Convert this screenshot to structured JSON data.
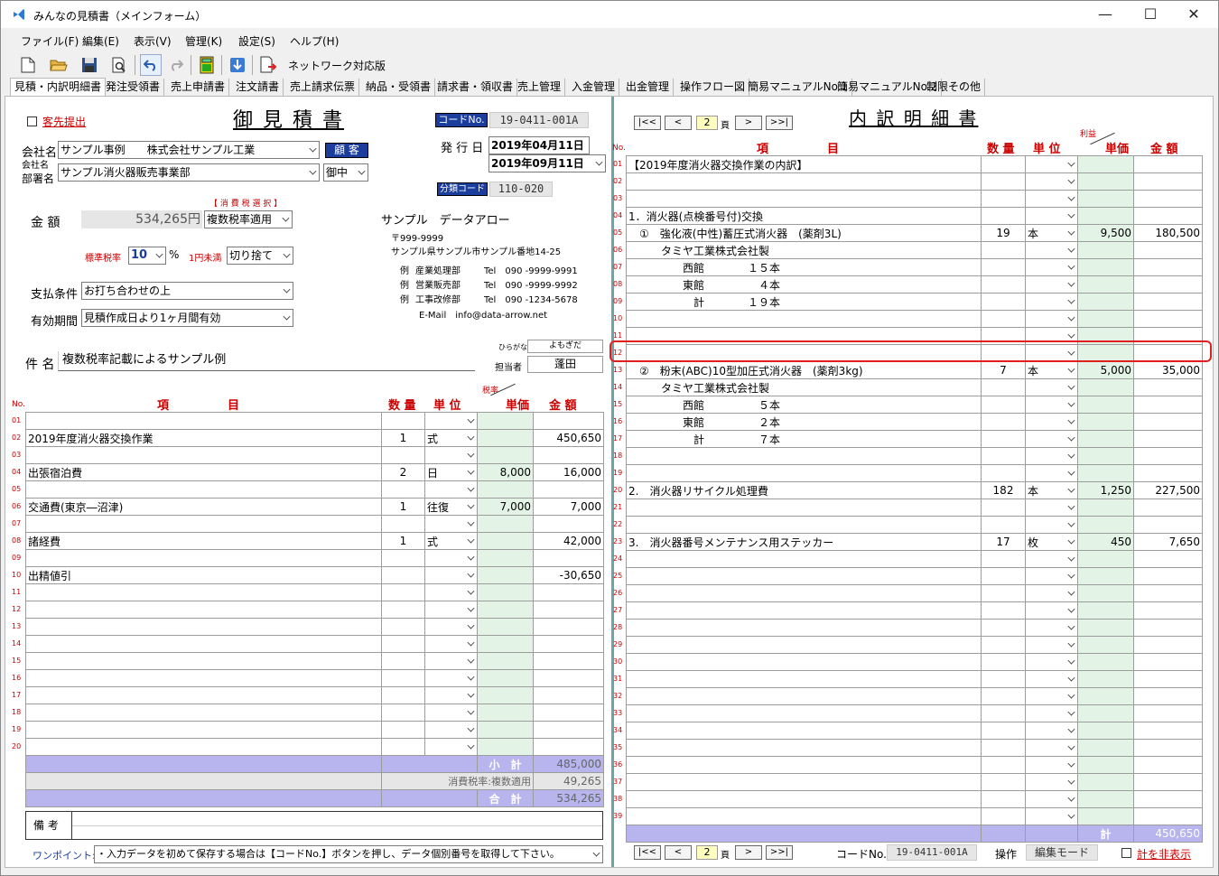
{
  "window": {
    "title": "みんなの見積書（メインフォーム）"
  },
  "menu": [
    "ファイル(F)",
    "編集(E)",
    "表示(V)",
    "管理(K)",
    "設定(S)",
    "ヘルプ(H)"
  ],
  "toolbar": {
    "network_label": "ネットワーク対応版"
  },
  "tabs": [
    "見積・内訳明細書",
    "発注受領書",
    "売上申請書",
    "注文請書",
    "売上請求伝票",
    "納品・受領書",
    "請求書・領収書",
    "売上管理",
    "入金管理",
    "出金管理",
    "操作フロー図",
    "簡易マニュアルNo.1",
    "簡易マニュアルNo.2",
    "制限その他"
  ],
  "estimate": {
    "send_label": "客先提出",
    "title": "御 見 積 書",
    "code_label": "コードNo.",
    "code_value": "19-0411-001A",
    "issue_label": "発 行 日",
    "issue_date": "2019年04月11日",
    "due_date": "2019年09月11日",
    "class_label": "分類コード",
    "class_value": "110-020",
    "company_label": "会社名",
    "company_value": "サンプル事例　　株式会社サンプル工業",
    "customer_btn": "顧 客",
    "dept_label1": "会社名",
    "dept_label2": "部署名",
    "dept_value": "サンプル消火器販売事業部",
    "honorific": "御中",
    "tax_select_label": "【 消 費 税 選 択 】",
    "amount_label": "金 額",
    "amount_value": "534,265円",
    "tax_mode": "複数税率適用",
    "std_rate_label": "標準税率",
    "std_rate": "10",
    "percent": "%",
    "rounding_label": "1円未満",
    "rounding": "切り捨て",
    "pay_label": "支払条件",
    "pay_value": "お打ち合わせの上",
    "valid_label": "有効期間",
    "valid_value": "見積作成日より1ヶ月間有効",
    "subject_label": "件 名",
    "subject_value": "複数税率記載によるサンプル例",
    "kana_label": "ひらがな",
    "kana_value": "よもぎだ",
    "person_label": "担当者",
    "person_value": "蓬田",
    "note_label": "備 考",
    "onepoint_label": "ワンポイント:",
    "onepoint_value": "・入力データを初めて保存する場合は【コードNo.】ボタンを押し、データ個別番号を取得して下さい。"
  },
  "company_info": {
    "name": "サンプル　データアロー",
    "zip": "〒999-9999",
    "address": "サンプル県サンプル市サンプル番地14-25",
    "lines": [
      {
        "ex": "例",
        "dept": "産業処理部",
        "tel": "Tel　090 -9999-9991"
      },
      {
        "ex": "例",
        "dept": "営業販売部",
        "tel": "Tel　090 -9999-9992"
      },
      {
        "ex": "例",
        "dept": "工事改修部",
        "tel": "Tel　090 -1234-5678"
      }
    ],
    "email": "E-Mail　info@data-arrow.net"
  },
  "left_table": {
    "headers": {
      "no": "No.",
      "item": "項　　　　　目",
      "qty": "数 量",
      "unit": "単 位",
      "taxrate": "税率",
      "price": "単価",
      "amount": "金 額"
    },
    "rows": [
      {
        "no": "01",
        "item": "",
        "qty": "",
        "unit": "",
        "price": "",
        "amount": ""
      },
      {
        "no": "02",
        "item": "2019年度消火器交換作業",
        "qty": "1",
        "unit": "式",
        "price": "",
        "amount": "450,650"
      },
      {
        "no": "03",
        "item": "",
        "qty": "",
        "unit": "",
        "price": "",
        "amount": ""
      },
      {
        "no": "04",
        "item": "出張宿泊費",
        "qty": "2",
        "unit": "日",
        "price": "8,000",
        "amount": "16,000"
      },
      {
        "no": "05",
        "item": "",
        "qty": "",
        "unit": "",
        "price": "",
        "amount": ""
      },
      {
        "no": "06",
        "item": "交通費(東京―沼津)",
        "qty": "1",
        "unit": "往復",
        "price": "7,000",
        "amount": "7,000"
      },
      {
        "no": "07",
        "item": "",
        "qty": "",
        "unit": "",
        "price": "",
        "amount": ""
      },
      {
        "no": "08",
        "item": "諸経費",
        "qty": "1",
        "unit": "式",
        "price": "",
        "amount": "42,000"
      },
      {
        "no": "09",
        "item": "",
        "qty": "",
        "unit": "",
        "price": "",
        "amount": ""
      },
      {
        "no": "10",
        "item": "出精値引",
        "qty": "",
        "unit": "",
        "price": "",
        "amount": "-30,650"
      },
      {
        "no": "11",
        "item": "",
        "qty": "",
        "unit": "",
        "price": "",
        "amount": ""
      },
      {
        "no": "12",
        "item": "",
        "qty": "",
        "unit": "",
        "price": "",
        "amount": ""
      },
      {
        "no": "13",
        "item": "",
        "qty": "",
        "unit": "",
        "price": "",
        "amount": ""
      },
      {
        "no": "14",
        "item": "",
        "qty": "",
        "unit": "",
        "price": "",
        "amount": ""
      },
      {
        "no": "15",
        "item": "",
        "qty": "",
        "unit": "",
        "price": "",
        "amount": ""
      },
      {
        "no": "16",
        "item": "",
        "qty": "",
        "unit": "",
        "price": "",
        "amount": ""
      },
      {
        "no": "17",
        "item": "",
        "qty": "",
        "unit": "",
        "price": "",
        "amount": ""
      },
      {
        "no": "18",
        "item": "",
        "qty": "",
        "unit": "",
        "price": "",
        "amount": ""
      },
      {
        "no": "19",
        "item": "",
        "qty": "",
        "unit": "",
        "price": "",
        "amount": ""
      },
      {
        "no": "20",
        "item": "",
        "qty": "",
        "unit": "",
        "price": "",
        "amount": ""
      }
    ],
    "subtotal_label": "小　計",
    "subtotal": "485,000",
    "tax_label": "消費税率:複数適用",
    "tax": "49,265",
    "total_label": "合　計",
    "total": "534,265"
  },
  "breakdown": {
    "title": "内 訳 明 細 書",
    "page": "2",
    "page_suffix": "頁",
    "profit_label": "利益",
    "headers": {
      "no": "No.",
      "item": "項　　　　　目",
      "qty": "数 量",
      "unit": "単 位",
      "price": "単価",
      "amount": "金 額"
    },
    "rows": [
      {
        "no": "01",
        "item": "【2019年度消火器交換作業の内訳】",
        "qty": "",
        "unit": "",
        "price": "",
        "amount": ""
      },
      {
        "no": "02",
        "item": "",
        "qty": "",
        "unit": "",
        "price": "",
        "amount": ""
      },
      {
        "no": "03",
        "item": "",
        "qty": "",
        "unit": "",
        "price": "",
        "amount": ""
      },
      {
        "no": "04",
        "item": "1．消火器(点検番号付)交換",
        "qty": "",
        "unit": "",
        "price": "",
        "amount": ""
      },
      {
        "no": "05",
        "item": "　①　強化液(中性)蓄圧式消火器　(薬剤3L)",
        "qty": "19",
        "unit": "本",
        "price": "9,500",
        "amount": "180,500"
      },
      {
        "no": "06",
        "item": "　　　タミヤ工業株式会社製",
        "qty": "",
        "unit": "",
        "price": "",
        "amount": ""
      },
      {
        "no": "07",
        "item": "　　　　　西館　　　　１５本",
        "qty": "",
        "unit": "",
        "price": "",
        "amount": ""
      },
      {
        "no": "08",
        "item": "　　　　　東館　　　　　４本",
        "qty": "",
        "unit": "",
        "price": "",
        "amount": ""
      },
      {
        "no": "09",
        "item": "　　　　　　計　　　　１９本",
        "qty": "",
        "unit": "",
        "price": "",
        "amount": ""
      },
      {
        "no": "10",
        "item": "",
        "qty": "",
        "unit": "",
        "price": "",
        "amount": ""
      },
      {
        "no": "11",
        "item": "",
        "qty": "",
        "unit": "",
        "price": "",
        "amount": ""
      },
      {
        "no": "12",
        "item": "",
        "qty": "",
        "unit": "",
        "price": "",
        "amount": ""
      },
      {
        "no": "13",
        "item": "　②　粉末(ABC)10型加圧式消火器　(薬剤3kg)",
        "qty": "7",
        "unit": "本",
        "price": "5,000",
        "amount": "35,000"
      },
      {
        "no": "14",
        "item": "　　　タミヤ工業株式会社製",
        "qty": "",
        "unit": "",
        "price": "",
        "amount": ""
      },
      {
        "no": "15",
        "item": "　　　　　西館　　　　　５本",
        "qty": "",
        "unit": "",
        "price": "",
        "amount": ""
      },
      {
        "no": "16",
        "item": "　　　　　東館　　　　　２本",
        "qty": "",
        "unit": "",
        "price": "",
        "amount": ""
      },
      {
        "no": "17",
        "item": "　　　　　　計　　　　　７本",
        "qty": "",
        "unit": "",
        "price": "",
        "amount": ""
      },
      {
        "no": "18",
        "item": "",
        "qty": "",
        "unit": "",
        "price": "",
        "amount": ""
      },
      {
        "no": "19",
        "item": "",
        "qty": "",
        "unit": "",
        "price": "",
        "amount": ""
      },
      {
        "no": "20",
        "item": "2.　消火器リサイクル処理費",
        "qty": "182",
        "unit": "本",
        "price": "1,250",
        "amount": "227,500"
      },
      {
        "no": "21",
        "item": "",
        "qty": "",
        "unit": "",
        "price": "",
        "amount": ""
      },
      {
        "no": "22",
        "item": "",
        "qty": "",
        "unit": "",
        "price": "",
        "amount": ""
      },
      {
        "no": "23",
        "item": "3.　消火器番号メンテナンス用ステッカー",
        "qty": "17",
        "unit": "枚",
        "price": "450",
        "amount": "7,650"
      },
      {
        "no": "24",
        "item": "",
        "qty": "",
        "unit": "",
        "price": "",
        "amount": ""
      },
      {
        "no": "25",
        "item": "",
        "qty": "",
        "unit": "",
        "price": "",
        "amount": ""
      },
      {
        "no": "26",
        "item": "",
        "qty": "",
        "unit": "",
        "price": "",
        "amount": ""
      },
      {
        "no": "27",
        "item": "",
        "qty": "",
        "unit": "",
        "price": "",
        "amount": ""
      },
      {
        "no": "28",
        "item": "",
        "qty": "",
        "unit": "",
        "price": "",
        "amount": ""
      },
      {
        "no": "29",
        "item": "",
        "qty": "",
        "unit": "",
        "price": "",
        "amount": ""
      },
      {
        "no": "30",
        "item": "",
        "qty": "",
        "unit": "",
        "price": "",
        "amount": ""
      },
      {
        "no": "31",
        "item": "",
        "qty": "",
        "unit": "",
        "price": "",
        "amount": ""
      },
      {
        "no": "32",
        "item": "",
        "qty": "",
        "unit": "",
        "price": "",
        "amount": ""
      },
      {
        "no": "33",
        "item": "",
        "qty": "",
        "unit": "",
        "price": "",
        "amount": ""
      },
      {
        "no": "34",
        "item": "",
        "qty": "",
        "unit": "",
        "price": "",
        "amount": ""
      },
      {
        "no": "35",
        "item": "",
        "qty": "",
        "unit": "",
        "price": "",
        "amount": ""
      },
      {
        "no": "36",
        "item": "",
        "qty": "",
        "unit": "",
        "price": "",
        "amount": ""
      },
      {
        "no": "37",
        "item": "",
        "qty": "",
        "unit": "",
        "price": "",
        "amount": ""
      },
      {
        "no": "38",
        "item": "",
        "qty": "",
        "unit": "",
        "price": "",
        "amount": ""
      },
      {
        "no": "39",
        "item": "",
        "qty": "",
        "unit": "",
        "price": "",
        "amount": ""
      }
    ],
    "total_label": "計",
    "total": "450,650",
    "code_label": "コードNo.",
    "code_value": "19-0411-001A",
    "op_label": "操作",
    "mode_value": "編集モード",
    "hide_label": "計を非表示"
  },
  "colors": {
    "accent_blue": "#1a3d9e",
    "price_green": "#e3f3e6",
    "sum_purple": "#b7b4ee",
    "row_no_red": "#cc0000",
    "highlight": "#e02020"
  }
}
